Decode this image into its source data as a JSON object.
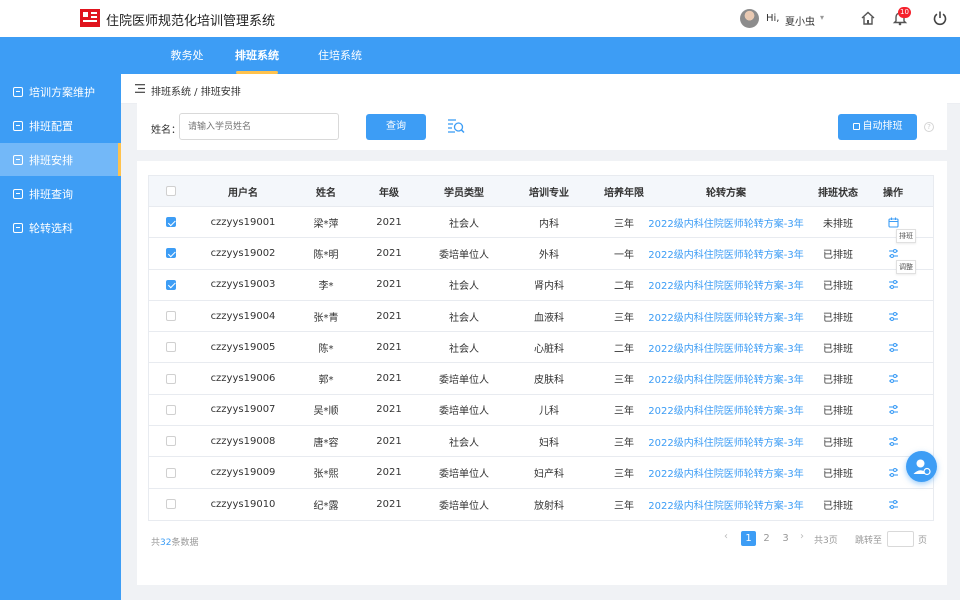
{
  "app": {
    "title": "住院医师规范化培训管理系统"
  },
  "user": {
    "greeting": "Hi,",
    "name": "夏小虫",
    "caret": "▾",
    "notification_count": "10"
  },
  "nav": {
    "tabs": [
      {
        "label": "教务处"
      },
      {
        "label": "排班系统"
      },
      {
        "label": "住培系统"
      }
    ],
    "active_index": 1
  },
  "sidebar": {
    "items": [
      {
        "label": "培训方案维护"
      },
      {
        "label": "排班配置"
      },
      {
        "label": "排班安排"
      },
      {
        "label": "排班查询"
      },
      {
        "label": "轮转选科"
      }
    ],
    "active_index": 2
  },
  "breadcrumb": {
    "text": "排班系统 / 排班安排"
  },
  "search": {
    "label": "姓名：",
    "placeholder": "请输入学员姓名",
    "query_label": "查询",
    "auto_label": "自动排班",
    "help_glyph": "?"
  },
  "table": {
    "headers": [
      "用户名",
      "姓名",
      "年级",
      "学员类型",
      "培训专业",
      "培养年限",
      "轮转方案",
      "排班状态",
      "操作"
    ],
    "rows": [
      {
        "checked": true,
        "username": "czzyys19001",
        "name": "梁*萍",
        "grade": "2021",
        "type": "社会人",
        "major": "内科",
        "years": "三年",
        "plan": "2022级内科住院医师轮转方案-3年",
        "status": "未排班",
        "tip": "排班"
      },
      {
        "checked": true,
        "username": "czzyys19002",
        "name": "陈*明",
        "grade": "2021",
        "type": "委培单位人",
        "major": "外科",
        "years": "一年",
        "plan": "2022级内科住院医师轮转方案-3年",
        "status": "已排班",
        "tip": "调整"
      },
      {
        "checked": true,
        "username": "czzyys19003",
        "name": "李*",
        "grade": "2021",
        "type": "社会人",
        "major": "肾内科",
        "years": "二年",
        "plan": "2022级内科住院医师轮转方案-3年",
        "status": "已排班"
      },
      {
        "checked": false,
        "username": "czzyys19004",
        "name": "张*青",
        "grade": "2021",
        "type": "社会人",
        "major": "血液科",
        "years": "三年",
        "plan": "2022级内科住院医师轮转方案-3年",
        "status": "已排班"
      },
      {
        "checked": false,
        "username": "czzyys19005",
        "name": "陈*",
        "grade": "2021",
        "type": "社会人",
        "major": "心脏科",
        "years": "二年",
        "plan": "2022级内科住院医师轮转方案-3年",
        "status": "已排班"
      },
      {
        "checked": false,
        "username": "czzyys19006",
        "name": "郭*",
        "grade": "2021",
        "type": "委培单位人",
        "major": "皮肤科",
        "years": "三年",
        "plan": "2022级内科住院医师轮转方案-3年",
        "status": "已排班"
      },
      {
        "checked": false,
        "username": "czzyys19007",
        "name": "吴*顺",
        "grade": "2021",
        "type": "委培单位人",
        "major": "儿科",
        "years": "三年",
        "plan": "2022级内科住院医师轮转方案-3年",
        "status": "已排班"
      },
      {
        "checked": false,
        "username": "czzyys19008",
        "name": "唐*容",
        "grade": "2021",
        "type": "社会人",
        "major": "妇科",
        "years": "三年",
        "plan": "2022级内科住院医师轮转方案-3年",
        "status": "已排班"
      },
      {
        "checked": false,
        "username": "czzyys19009",
        "name": "张*熙",
        "grade": "2021",
        "type": "委培单位人",
        "major": "妇产科",
        "years": "三年",
        "plan": "2022级内科住院医师轮转方案-3年",
        "status": "已排班"
      },
      {
        "checked": false,
        "username": "czzyys19010",
        "name": "纪*露",
        "grade": "2021",
        "type": "委培单位人",
        "major": "放射科",
        "years": "三年",
        "plan": "2022级内科住院医师轮转方案-3年",
        "status": "已排班"
      }
    ]
  },
  "footer": {
    "total_prefix": "共",
    "total_count": "32",
    "total_suffix": "条数据",
    "prev": "‹",
    "next": "›",
    "pages": [
      "1",
      "2",
      "3"
    ],
    "current_page": "1",
    "page_total": "共3页",
    "jump_label": "跳转至",
    "jump_unit": "页"
  },
  "colors": {
    "primary": "#3d9df5",
    "accent": "#ffc24d",
    "badge": "#f5222d"
  }
}
